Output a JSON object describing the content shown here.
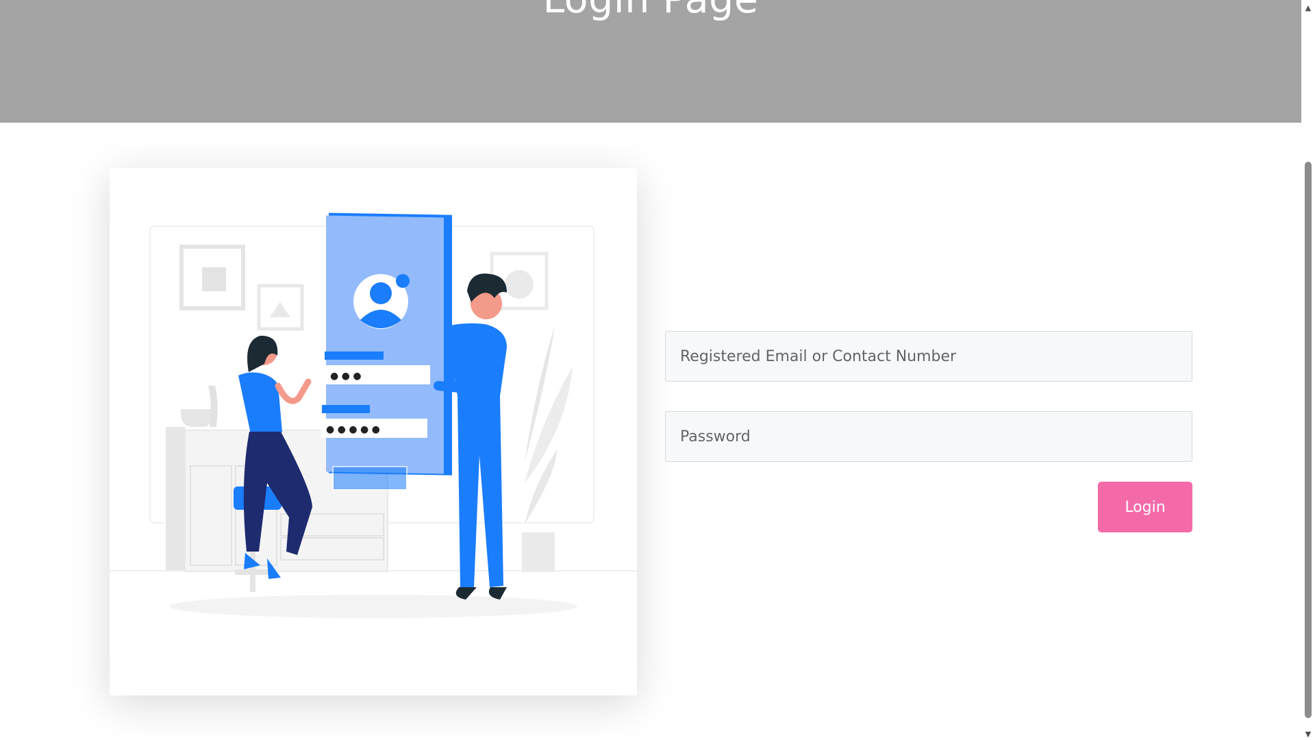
{
  "header": {
    "title": "Login Page"
  },
  "illustration": {
    "icon": "login-illustration",
    "password_dots_short": "● ● ●",
    "password_dots_long": "● ● ● ● ●"
  },
  "form": {
    "email_placeholder": "Registered Email or Contact Number",
    "email_value": "",
    "password_placeholder": "Password",
    "password_value": "",
    "login_label": "Login"
  },
  "colors": {
    "header_bg": "#a4a4a4",
    "accent": "#f46aa9",
    "illustration_blue": "#1a7dfc"
  },
  "scrollbar": {
    "up_icon": "▲",
    "down_icon": "▼"
  }
}
